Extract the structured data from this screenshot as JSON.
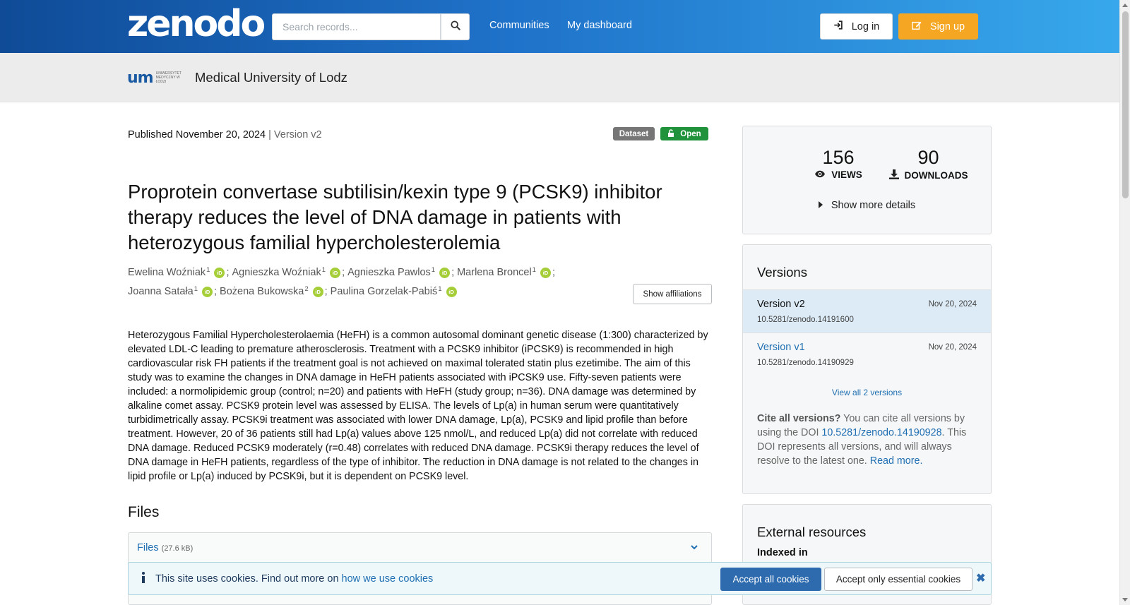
{
  "header": {
    "logo_text": "zenodo",
    "search_placeholder": "Search records...",
    "nav": [
      "Communities",
      "My dashboard"
    ],
    "login_label": "Log in",
    "signup_label": "Sign up",
    "colors": {
      "gradient_start": "#0f4b97",
      "gradient_end": "#38a9ec",
      "signup": "#f5a623"
    }
  },
  "community": {
    "logo_text": "um",
    "logo_subtext": "UNIWERSYTET MEDYCZNY W ŁODZI",
    "name": "Medical University of Lodz"
  },
  "record": {
    "published": "Published November 20, 2024",
    "version_sep": " | ",
    "version": "Version v2",
    "badge_type": "Dataset",
    "badge_access": "Open",
    "title": "Proprotein convertase subtilisin/kexin type 9 (PCSK9) inhibitor therapy reduces the level of DNA damage in patients with heterozygous familial hypercholesterolemia",
    "authors": [
      {
        "name": "Ewelina Woźniak",
        "aff": "1"
      },
      {
        "name": "Agnieszka Woźniak",
        "aff": "1"
      },
      {
        "name": "Agnieszka Pawlos",
        "aff": "1"
      },
      {
        "name": "Marlena Broncel",
        "aff": "1"
      },
      {
        "name": "Joanna Satała",
        "aff": "1"
      },
      {
        "name": "Bożena Bukowska",
        "aff": "2"
      },
      {
        "name": "Paulina Gorzelak-Pabiś",
        "aff": "1"
      }
    ],
    "orcid_label": "iD",
    "author_sep": ";",
    "show_affiliations": "Show affiliations",
    "abstract": "Heterozygous Familial Hypercholesterolaemia (HeFH) is a common autosomal dominant genetic disease (1:300) characterized by elevated LDL-C leading to premature atherosclerosis. Treatment with a PCSK9 inhibitor (iPCSK9) is recommended in high cardiovascular risk FH patients if the treatment goal is not achieved on maximal tolerated statin plus ezetimibe. The aim of this study was to examine the changes in DNA damage in HeFH patients associated with iPCSK9 use. Fifty-seven patients were included: a normolipidemic group (control; n=20) and patients with HeFH (study group; n=36). DNA damage was determined by alkaline comet assay. PCSK9 protein level was assessed by ELISA. The levels of Lp(a) in human serum were quantitatively turbidimetrically assay. PCSK9i treatment was associated with lower DNA damage, Lp(a), PCSK9 and lipid profile than before treatment. However, 20 of 36 patients still had Lp(a) values above 125 nmol/L, and reduced Lp(a) did not correlate with reduced DNA damage. Reduced PCSK9 moderately (r=0.48) correlates with reduced DNA damage. PCSK9i therapy reduces the level of DNA damage in HeFH patients, regardless of the type of inhibitor. The reduction in DNA damage is not related to the changes in lipid profile or Lp(a) induced by PCSK9i, but it is dependent on PCSK9 level.",
    "files_heading": "Files",
    "files_label": "Files",
    "files_size": "(27.6 kB)"
  },
  "stats": {
    "views": "156",
    "views_label": "VIEWS",
    "downloads": "90",
    "downloads_label": "DOWNLOADS",
    "show_more": "Show more details"
  },
  "versions": {
    "heading": "Versions",
    "items": [
      {
        "label": "Version v2",
        "date": "Nov 20, 2024",
        "doi": "10.5281/zenodo.14191600",
        "active": true
      },
      {
        "label": "Version v1",
        "date": "Nov 20, 2024",
        "doi": "10.5281/zenodo.14190929",
        "active": false
      }
    ],
    "view_all": "View all 2 versions",
    "cite_bold": "Cite all versions?",
    "cite_pre": " You can cite all versions by using the DOI ",
    "cite_doi": "10.5281/zenodo.14190928",
    "cite_post": ". This DOI represents all versions, and will always resolve to the latest one. ",
    "read_more": "Read more."
  },
  "external": {
    "heading": "External resources",
    "indexed_in": "Indexed in"
  },
  "cookie": {
    "text": "This site uses cookies. Find out more on ",
    "link": "how we use cookies",
    "accept_all": "Accept all cookies",
    "accept_essential": "Accept only essential cookies"
  }
}
